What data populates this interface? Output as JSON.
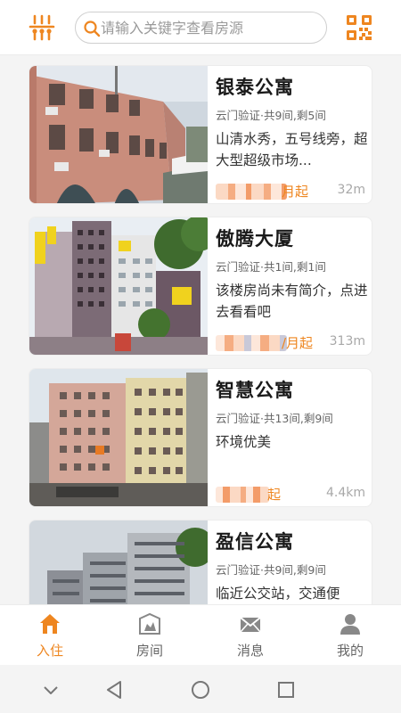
{
  "colors": {
    "accent": "#ee8620",
    "text_primary": "#1a1a1a",
    "text_secondary": "#666666",
    "muted": "#a8a8a8"
  },
  "topbar": {
    "filter_icon": "filter-sliders-icon",
    "search": {
      "placeholder": "请输入关键字查看房源",
      "icon": "search-icon"
    },
    "qr_icon": "qr-code-icon"
  },
  "listings": [
    {
      "title": "银泰公寓",
      "meta": "云门验证·共9间,剩5间",
      "desc": "山清水秀，五号线旁，超大型超级市场...",
      "price_suffix": "月起",
      "distance": "32m"
    },
    {
      "title": "傲腾大厦",
      "meta": "云门验证·共1间,剩1间",
      "desc": "该楼房尚未有简介，点进去看看吧",
      "price_suffix": "/月起",
      "distance": "313m"
    },
    {
      "title": "智慧公寓",
      "meta": "云门验证·共13间,剩9间",
      "desc": "环境优美",
      "price_suffix": "起",
      "distance": "4.4km"
    },
    {
      "title": "盈信公寓",
      "meta": "云门验证·共9间,剩9间",
      "desc": "临近公交站，交通便",
      "price_suffix": "",
      "distance": ""
    }
  ],
  "bottom_nav": {
    "items": [
      {
        "label": "入住",
        "icon": "home-icon",
        "active": true
      },
      {
        "label": "房间",
        "icon": "room-icon",
        "active": false
      },
      {
        "label": "消息",
        "icon": "mail-icon",
        "active": false
      },
      {
        "label": "我的",
        "icon": "user-icon",
        "active": false
      }
    ]
  },
  "system_nav": [
    "chevron-down-icon",
    "back-icon",
    "home-circle-icon",
    "recents-icon"
  ]
}
